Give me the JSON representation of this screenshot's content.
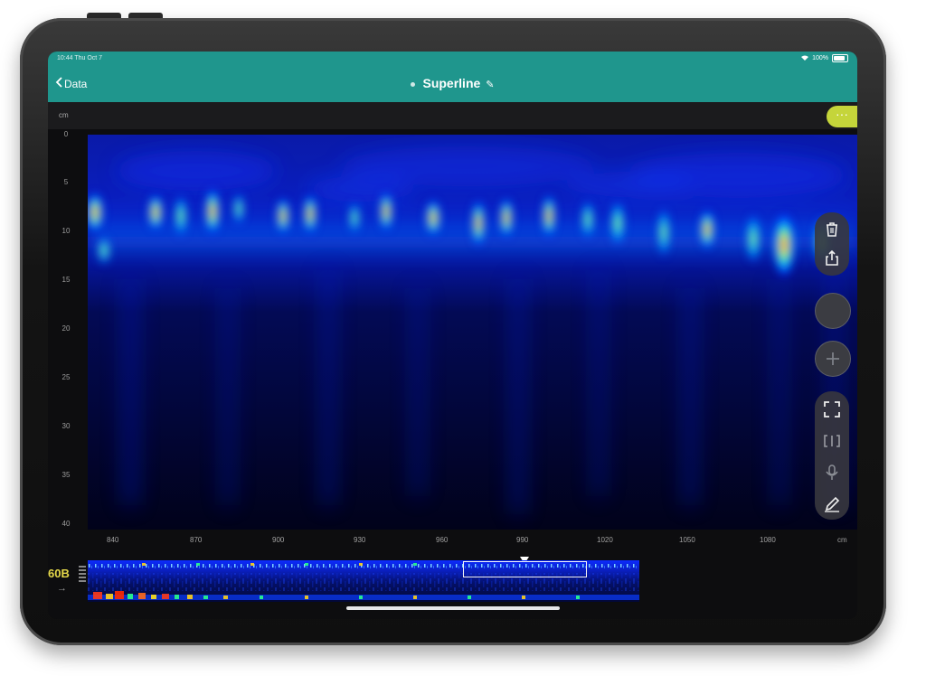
{
  "status_bar": {
    "left_text": "10:44 Thu Oct 7",
    "battery_text": "100%"
  },
  "nav": {
    "back_label": "Data",
    "title": "Superline"
  },
  "toolbar": {
    "more_label": "···"
  },
  "chart": {
    "depth_unit": "cm",
    "y_ticks": [
      "0",
      "5",
      "10",
      "15",
      "20",
      "25",
      "30",
      "35",
      "40"
    ],
    "x_ticks": [
      "840",
      "870",
      "900",
      "930",
      "960",
      "990",
      "1020",
      "1050",
      "1080"
    ],
    "x_unit": "cm"
  },
  "overview": {
    "gain_label": "60B",
    "arrow": "→"
  },
  "tools": {
    "delete": "trash-icon",
    "share": "share-icon",
    "record": "record-button",
    "add": "add-button",
    "fit": "fit-screen-icon",
    "split": "split-view-icon",
    "mic": "microphone-icon",
    "annotate": "pencil-icon"
  }
}
